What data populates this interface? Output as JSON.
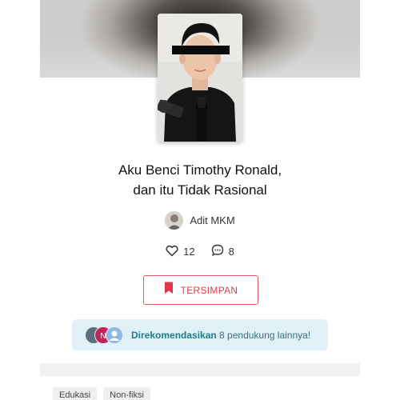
{
  "story": {
    "title_line1": "Aku Benci Timothy Ronald,",
    "title_line2": "dan itu Tidak Rasional",
    "author": "Adit MKM"
  },
  "stats": {
    "likes": "12",
    "comments": "8"
  },
  "actions": {
    "saved_label": "TERSIMPAN"
  },
  "recommendation": {
    "highlight": "Direkomendasikan",
    "rest": " 8 pendukung lainnya!"
  },
  "tags": [
    "Edukasi",
    "Non-fiksi"
  ],
  "colors": {
    "accent": "#e0394b",
    "recommend_bg": "#dff1f6",
    "recommend_text": "#1e7d8c"
  }
}
